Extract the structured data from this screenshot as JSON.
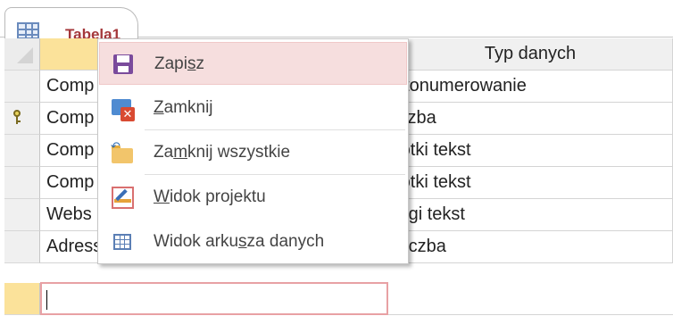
{
  "tab": {
    "title": "Tabela1",
    "icon": "table-icon"
  },
  "grid": {
    "columns": [
      "",
      "Typ danych"
    ],
    "rows": [
      {
        "field": "Comp",
        "type": "utonumerowanie",
        "key": false
      },
      {
        "field": "Comp",
        "type": "iczba",
        "key": true
      },
      {
        "field": "Comp",
        "type": "rótki tekst",
        "key": false
      },
      {
        "field": "Comp",
        "type": "rótki tekst",
        "key": false
      },
      {
        "field": "Webs",
        "type": "ługi tekst",
        "key": false
      },
      {
        "field": "Adress_ID",
        "type": "Liczba",
        "key": false
      }
    ],
    "new_row": {
      "field": "",
      "type": ""
    }
  },
  "menu": {
    "items": [
      {
        "pre": "Zapi",
        "u": "s",
        "post": "z",
        "icon": "save-icon"
      },
      {
        "pre": "",
        "u": "Z",
        "post": "amknij",
        "icon": "close-icon"
      },
      {
        "pre": "Za",
        "u": "m",
        "post": "knij wszystkie",
        "icon": "close-all-icon"
      },
      {
        "pre": "",
        "u": "W",
        "post": "idok projektu",
        "icon": "design-view-icon"
      },
      {
        "pre": "Widok arku",
        "u": "s",
        "post": "za danych",
        "icon": "datasheet-view-icon"
      }
    ]
  },
  "colors": {
    "tab_title": "#a4373a",
    "selected_header": "#fbe29a",
    "menu_hover": "#f6dede",
    "save_icon": "#7a4b9c",
    "close_badge": "#d94a32"
  }
}
